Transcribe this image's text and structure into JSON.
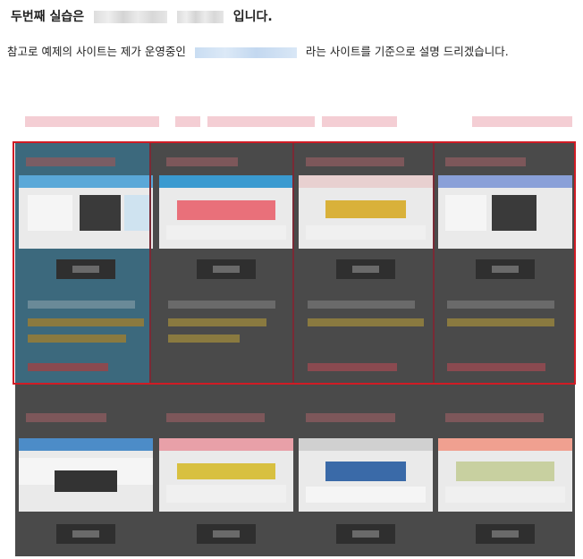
{
  "line1": {
    "before": "두번째 실습은",
    "after": "입니다."
  },
  "line2": {
    "before": "참고로 예제의 사이트는 제가 운영중인",
    "after": "라는 사이트를 기준으로 설명 드리겠습니다."
  },
  "colors": {
    "grid_background": "#4a4a4a",
    "selection_border": "#d01c25",
    "highlight_column": "#3a6f86"
  },
  "screenshot_cards": [
    {
      "accent": "#5aa8d8"
    },
    {
      "accent": "#3a9ad0"
    },
    {
      "accent": "#d9b13a"
    },
    {
      "accent": "#8aa0d8"
    },
    {
      "accent": "#4c8cc8"
    },
    {
      "accent": "#d8c040"
    },
    {
      "accent": "#3a6aa8"
    },
    {
      "accent": "#f0a090"
    }
  ]
}
